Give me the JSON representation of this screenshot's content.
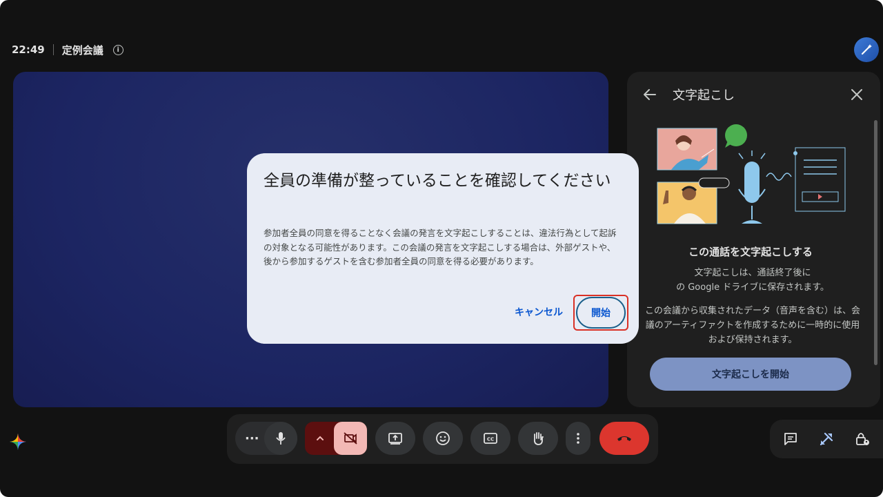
{
  "header": {
    "time": "22:49",
    "meeting_title": "定例会議"
  },
  "side_panel": {
    "title": "文字起こし",
    "heading": "この通話を文字起こしする",
    "text_1": "文字起こしは、通話終了後に\nの Google ドライブに保存されます。",
    "text_2": "この会議から収集されたデータ（音声を含む）は、会議のアーティファクトを作成するために一時的に使用および保持されます。",
    "start_button": "文字起こしを開始"
  },
  "dialog": {
    "title": "全員の準備が整っていることを確認してください",
    "body": "参加者全員の同意を得ることなく会議の発言を文字起こしすることは、違法行為として起訴の対象となる可能性があります。この会議の発言を文字起こしする場合は、外部ゲストや、後から参加するゲストを含む参加者全員の同意を得る必要があります。",
    "cancel_label": "キャンセル",
    "start_label": "開始"
  },
  "toolbar": {
    "more_label": "···"
  },
  "colors": {
    "accent": "#0b57d0",
    "leave": "#dc362e",
    "camera_off": "#f2b8b5",
    "highlight": "#d93025"
  }
}
